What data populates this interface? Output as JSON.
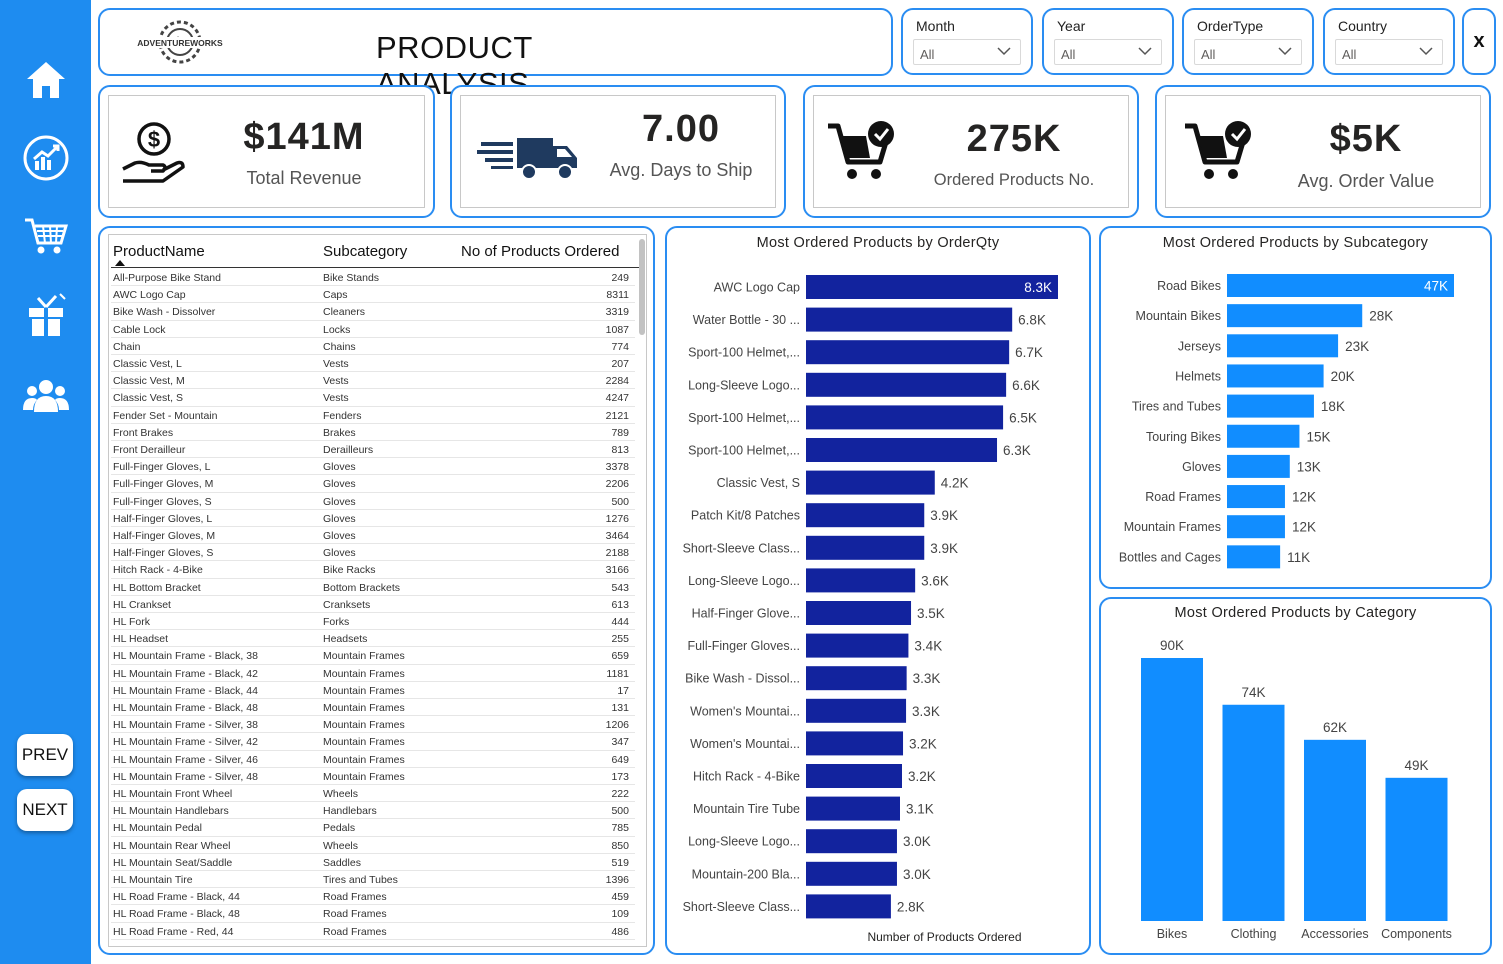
{
  "header": {
    "title": "PRODUCT ANALYSIS",
    "logo_text": "ADVENTUREWORKS",
    "close_label": "x",
    "slicers": [
      {
        "label": "Month",
        "value": "All"
      },
      {
        "label": "Year",
        "value": "All"
      },
      {
        "label": "OrderType",
        "value": "All"
      },
      {
        "label": "Country",
        "value": "All"
      }
    ]
  },
  "sidebar": {
    "icons": [
      "home-icon",
      "revenue-chart-icon",
      "cart-icon",
      "gift-icon",
      "people-icon"
    ],
    "prev_label": "PREV",
    "next_label": "NEXT"
  },
  "kpis": [
    {
      "value": "$141M",
      "label": "Total Revenue",
      "icon": "money-hand-icon"
    },
    {
      "value": "7.00",
      "label": "Avg. Days to Ship",
      "icon": "delivery-truck-icon"
    },
    {
      "value": "275K",
      "label": "Ordered Products No.",
      "icon": "cart-check-icon"
    },
    {
      "value": "$5K",
      "label": "Avg. Order Value",
      "icon": "cart-check-icon"
    }
  ],
  "table": {
    "headers": [
      "ProductName",
      "Subcategory",
      "No of Products Ordered"
    ],
    "rows": [
      [
        "All-Purpose Bike Stand",
        "Bike Stands",
        "249"
      ],
      [
        "AWC Logo Cap",
        "Caps",
        "8311"
      ],
      [
        "Bike Wash - Dissolver",
        "Cleaners",
        "3319"
      ],
      [
        "Cable Lock",
        "Locks",
        "1087"
      ],
      [
        "Chain",
        "Chains",
        "774"
      ],
      [
        "Classic Vest, L",
        "Vests",
        "207"
      ],
      [
        "Classic Vest, M",
        "Vests",
        "2284"
      ],
      [
        "Classic Vest, S",
        "Vests",
        "4247"
      ],
      [
        "Fender Set - Mountain",
        "Fenders",
        "2121"
      ],
      [
        "Front Brakes",
        "Brakes",
        "789"
      ],
      [
        "Front Derailleur",
        "Derailleurs",
        "813"
      ],
      [
        "Full-Finger Gloves, L",
        "Gloves",
        "3378"
      ],
      [
        "Full-Finger Gloves, M",
        "Gloves",
        "2206"
      ],
      [
        "Full-Finger Gloves, S",
        "Gloves",
        "500"
      ],
      [
        "Half-Finger Gloves, L",
        "Gloves",
        "1276"
      ],
      [
        "Half-Finger Gloves, M",
        "Gloves",
        "3464"
      ],
      [
        "Half-Finger Gloves, S",
        "Gloves",
        "2188"
      ],
      [
        "Hitch Rack - 4-Bike",
        "Bike Racks",
        "3166"
      ],
      [
        "HL Bottom Bracket",
        "Bottom Brackets",
        "543"
      ],
      [
        "HL Crankset",
        "Cranksets",
        "613"
      ],
      [
        "HL Fork",
        "Forks",
        "444"
      ],
      [
        "HL Headset",
        "Headsets",
        "255"
      ],
      [
        "HL Mountain Frame - Black, 38",
        "Mountain Frames",
        "659"
      ],
      [
        "HL Mountain Frame - Black, 42",
        "Mountain Frames",
        "1181"
      ],
      [
        "HL Mountain Frame - Black, 44",
        "Mountain Frames",
        "17"
      ],
      [
        "HL Mountain Frame - Black, 48",
        "Mountain Frames",
        "131"
      ],
      [
        "HL Mountain Frame - Silver, 38",
        "Mountain Frames",
        "1206"
      ],
      [
        "HL Mountain Frame - Silver, 42",
        "Mountain Frames",
        "347"
      ],
      [
        "HL Mountain Frame - Silver, 46",
        "Mountain Frames",
        "649"
      ],
      [
        "HL Mountain Frame - Silver, 48",
        "Mountain Frames",
        "173"
      ],
      [
        "HL Mountain Front Wheel",
        "Wheels",
        "222"
      ],
      [
        "HL Mountain Handlebars",
        "Handlebars",
        "500"
      ],
      [
        "HL Mountain Pedal",
        "Pedals",
        "785"
      ],
      [
        "HL Mountain Rear Wheel",
        "Wheels",
        "850"
      ],
      [
        "HL Mountain Seat/Saddle",
        "Saddles",
        "519"
      ],
      [
        "HL Mountain Tire",
        "Tires and Tubes",
        "1396"
      ],
      [
        "HL Road Frame - Black, 44",
        "Road Frames",
        "459"
      ],
      [
        "HL Road Frame - Black, 48",
        "Road Frames",
        "109"
      ],
      [
        "HL Road Frame - Red, 44",
        "Road Frames",
        "486"
      ]
    ]
  },
  "colors": {
    "accent": "#1e8cf0",
    "dark_bar": "#12239e",
    "light_bar": "#118dff"
  },
  "chart_data": [
    {
      "type": "bar",
      "orientation": "horizontal",
      "title": "Most Ordered Products by OrderQty",
      "xlabel": "Number of Products Ordered",
      "categories": [
        "AWC Logo Cap",
        "Water Bottle - 30 ...",
        "Sport-100 Helmet,...",
        "Long-Sleeve Logo...",
        "Sport-100 Helmet,...",
        "Sport-100 Helmet,...",
        "Classic Vest, S",
        "Patch Kit/8 Patches",
        "Short-Sleeve Class...",
        "Long-Sleeve Logo...",
        "Half-Finger Glove...",
        "Full-Finger Gloves...",
        "Bike Wash - Dissol...",
        "Women's Mountai...",
        "Women's Mountai...",
        "Hitch Rack - 4-Bike",
        "Mountain Tire Tube",
        "Long-Sleeve Logo...",
        "Mountain-200 Bla...",
        "Short-Sleeve Class..."
      ],
      "values": [
        8311,
        6800,
        6700,
        6600,
        6500,
        6300,
        4247,
        3900,
        3900,
        3600,
        3464,
        3378,
        3319,
        3300,
        3200,
        3166,
        3100,
        3000,
        3000,
        2800
      ],
      "labels": [
        "8.3K",
        "6.8K",
        "6.7K",
        "6.6K",
        "6.5K",
        "6.3K",
        "4.2K",
        "3.9K",
        "3.9K",
        "3.6K",
        "3.5K",
        "3.4K",
        "3.3K",
        "3.3K",
        "3.2K",
        "3.2K",
        "3.1K",
        "3.0K",
        "3.0K",
        "2.8K"
      ]
    },
    {
      "type": "bar",
      "orientation": "horizontal",
      "title": "Most Ordered Products by Subcategory",
      "categories": [
        "Road Bikes",
        "Mountain Bikes",
        "Jerseys",
        "Helmets",
        "Tires and Tubes",
        "Touring Bikes",
        "Gloves",
        "Road Frames",
        "Mountain Frames",
        "Bottles and Cages"
      ],
      "values": [
        47000,
        28000,
        23000,
        20000,
        18000,
        15000,
        13000,
        12000,
        12000,
        11000
      ],
      "labels": [
        "47K",
        "28K",
        "23K",
        "20K",
        "18K",
        "15K",
        "13K",
        "12K",
        "12K",
        "11K"
      ]
    },
    {
      "type": "bar",
      "orientation": "vertical",
      "title": "Most Ordered Products by Category",
      "categories": [
        "Bikes",
        "Clothing",
        "Accessories",
        "Components"
      ],
      "values": [
        90000,
        74000,
        62000,
        49000
      ],
      "labels": [
        "90K",
        "74K",
        "62K",
        "49K"
      ]
    }
  ]
}
